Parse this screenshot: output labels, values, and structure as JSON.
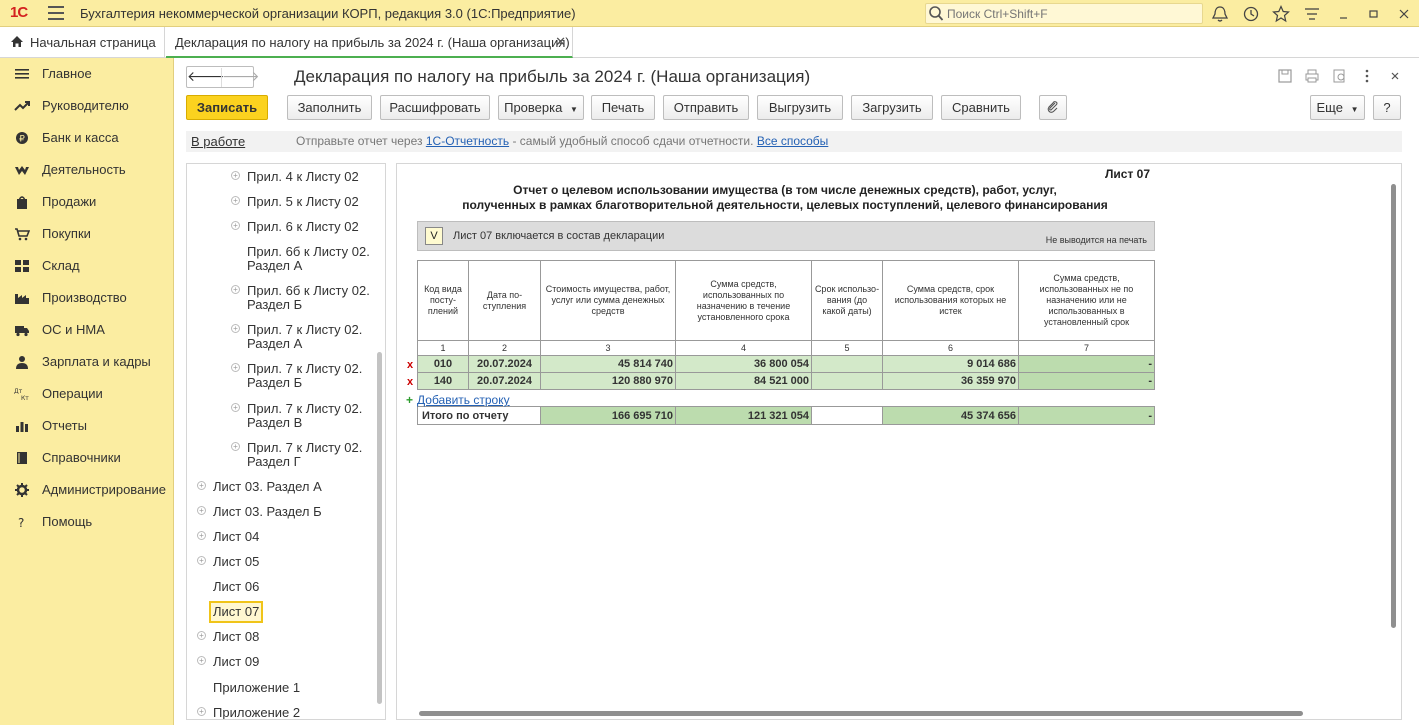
{
  "titlebar": {
    "logo": "1С",
    "app_title": "Бухгалтерия некоммерческой организации КОРП, редакция 3.0  (1С:Предприятие)",
    "search_placeholder": "Поиск Ctrl+Shift+F"
  },
  "tabs": {
    "home": "Начальная страница",
    "doc": "Декларация по налогу на прибыль за 2024 г. (Наша организация)"
  },
  "sidebar": {
    "items": [
      {
        "label": "Главное",
        "icon": "menu-icon"
      },
      {
        "label": "Руководителю",
        "icon": "trend-icon"
      },
      {
        "label": "Банк и касса",
        "icon": "coin-icon"
      },
      {
        "label": "Деятельность",
        "icon": "hands-icon"
      },
      {
        "label": "Продажи",
        "icon": "bag-icon"
      },
      {
        "label": "Покупки",
        "icon": "cart-icon"
      },
      {
        "label": "Склад",
        "icon": "warehouse-icon"
      },
      {
        "label": "Производство",
        "icon": "factory-icon"
      },
      {
        "label": "ОС и НМА",
        "icon": "truck-icon"
      },
      {
        "label": "Зарплата и кадры",
        "icon": "person-icon"
      },
      {
        "label": "Операции",
        "icon": "dt-kt-icon"
      },
      {
        "label": "Отчеты",
        "icon": "bar-chart-icon"
      },
      {
        "label": "Справочники",
        "icon": "book-icon"
      },
      {
        "label": "Администрирование",
        "icon": "gear-icon"
      },
      {
        "label": "Помощь",
        "icon": "question-icon"
      }
    ]
  },
  "document": {
    "title": "Декларация по налогу на прибыль за 2024 г. (Наша организация)"
  },
  "toolbar": {
    "save": "Записать",
    "fill": "Заполнить",
    "decode": "Расшифровать",
    "check": "Проверка",
    "print": "Печать",
    "send": "Отправить",
    "upload": "Выгрузить",
    "load": "Загрузить",
    "compare": "Сравнить",
    "more": "Еще",
    "help": "?"
  },
  "status": {
    "state": "В работе",
    "text_before": "Отправьте отчет через",
    "link1": "1С-Отчетность",
    "text_after": "- самый удобный способ сдачи отчетности.",
    "link2": "Все способы"
  },
  "tree": {
    "items": [
      {
        "l1": "Прил. 4 к Листу 02",
        "l2": ""
      },
      {
        "l1": "Прил. 5 к Листу 02",
        "l2": ""
      },
      {
        "l1": "Прил. 6 к Листу 02",
        "l2": ""
      },
      {
        "l1": "Прил. 6б к Листу 02.",
        "l2": "Раздел А"
      },
      {
        "l1": "Прил. 6б к Листу 02.",
        "l2": "Раздел Б"
      },
      {
        "l1": "Прил. 7 к Листу 02.",
        "l2": "Раздел А"
      },
      {
        "l1": "Прил. 7 к Листу 02.",
        "l2": "Раздел Б"
      },
      {
        "l1": "Прил. 7 к Листу 02.",
        "l2": "Раздел В"
      },
      {
        "l1": "Прил. 7 к Листу 02.",
        "l2": "Раздел Г"
      },
      {
        "l1": "Лист 03. Раздел А",
        "l2": ""
      },
      {
        "l1": "Лист 03. Раздел Б",
        "l2": ""
      },
      {
        "l1": "Лист 04",
        "l2": ""
      },
      {
        "l1": "Лист 05",
        "l2": ""
      },
      {
        "l1": "Лист 06",
        "l2": ""
      },
      {
        "l1": "Лист 07",
        "l2": ""
      },
      {
        "l1": "Лист 08",
        "l2": ""
      },
      {
        "l1": "Лист 09",
        "l2": ""
      },
      {
        "l1": "Приложение 1",
        "l2": ""
      },
      {
        "l1": "Приложение 2",
        "l2": ""
      }
    ]
  },
  "sheet": {
    "label": "Лист 07",
    "heading1": "Отчет о целевом использовании имущества (в том числе денежных средств), работ, услуг,",
    "heading2": "полученных в рамках благотворительной деятельности, целевых поступлений, целевого финансирования",
    "include_check": "V",
    "include_text": "Лист 07 включается в состав декларации",
    "include_note": "Не выводится на печать",
    "columns": [
      "Код вида посту-плений",
      "Дата по-ступления",
      "Стоимость имущества, работ, услуг или сумма денежных средств",
      "Сумма средств, использованных по назначению в течение установленного срока",
      "Срок использо-вания (до какой даты)",
      "Сумма средств, срок использования которых не истек",
      "Сумма средств, использованных не по назначению или не использованных в установленный срок"
    ],
    "column_numbers": [
      "1",
      "2",
      "3",
      "4",
      "5",
      "6",
      "7"
    ],
    "rows": [
      {
        "delete": "x",
        "code": "010",
        "date": "20.07.2024",
        "cost": "45 814 740",
        "used": "36 800 054",
        "term": "",
        "unexpired": "9 014 686",
        "misused": "-"
      },
      {
        "delete": "x",
        "code": "140",
        "date": "20.07.2024",
        "cost": "120 880 970",
        "used": "84 521 000",
        "term": "",
        "unexpired": "36 359 970",
        "misused": "-"
      }
    ],
    "add_row_plus": "+",
    "add_row": "Добавить строку",
    "total": {
      "label": "Итого по отчету",
      "cost": "166 695 710",
      "used": "121 321 054",
      "term": "",
      "unexpired": "45 374 656",
      "misused": "-"
    }
  }
}
